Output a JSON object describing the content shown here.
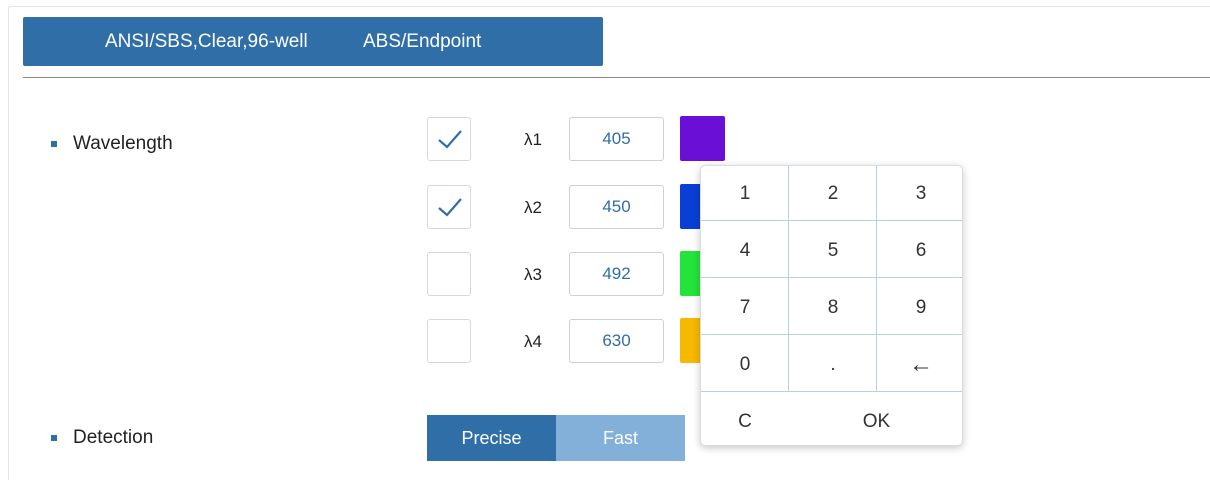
{
  "header": {
    "plate": "ANSI/SBS,Clear,96-well",
    "mode": "ABS/Endpoint",
    "color": "#2f6ea6"
  },
  "wavelength": {
    "label": "Wavelength",
    "rows": [
      {
        "lambda": "λ1",
        "value": "405",
        "checked": true,
        "color": "#6a0fd6"
      },
      {
        "lambda": "λ2",
        "value": "450",
        "checked": true,
        "color": "#0a3fd6"
      },
      {
        "lambda": "λ3",
        "value": "492",
        "checked": false,
        "color": "#22e43a"
      },
      {
        "lambda": "λ4",
        "value": "630",
        "checked": false,
        "color": "#f7b800"
      }
    ]
  },
  "detection": {
    "label": "Detection",
    "options": [
      "Precise",
      "Fast"
    ],
    "selected": "Precise"
  },
  "keypad": {
    "keys": [
      "1",
      "2",
      "3",
      "4",
      "5",
      "6",
      "7",
      "8",
      "9",
      "0",
      ".",
      "←",
      "C",
      "OK"
    ]
  }
}
